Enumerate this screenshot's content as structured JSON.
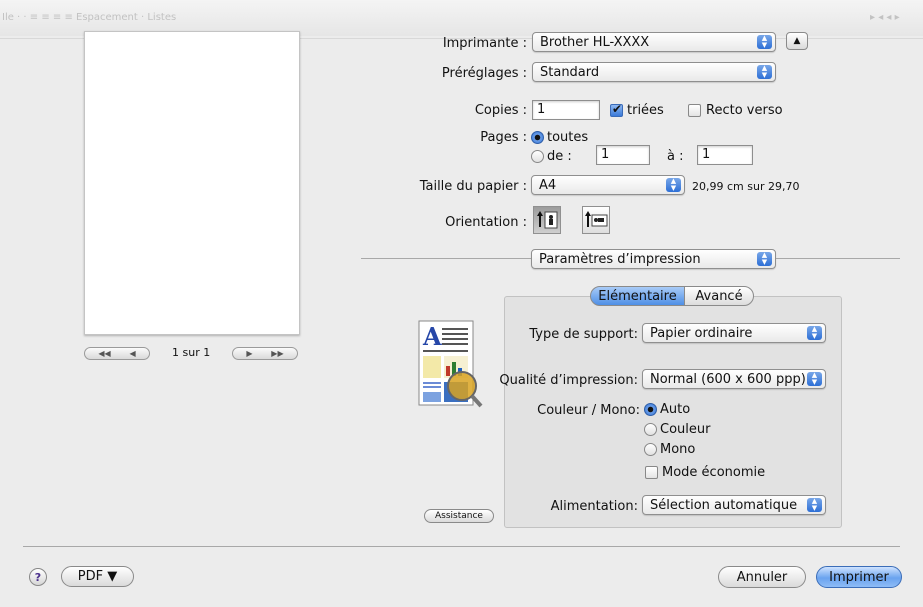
{
  "background_toolbar": {
    "text": "Ile · · ≡ ≡ ≡ ≡  Espacement  ·  Listes"
  },
  "preview": {
    "page_indicator": "1 sur 1"
  },
  "printer": {
    "label": "Imprimante :",
    "value": "Brother HL-XXXX"
  },
  "presets": {
    "label": "Préréglages :",
    "value": "Standard"
  },
  "copies": {
    "label": "Copies :",
    "value": "1",
    "collated_label": "triées",
    "collated": true,
    "duplex_label": "Recto verso",
    "duplex": false
  },
  "pages": {
    "label": "Pages :",
    "all_label": "toutes",
    "from_label": "de :",
    "from_value": "1",
    "to_label": "à :",
    "to_value": "1",
    "selected": "all"
  },
  "paper": {
    "label": "Taille du papier :",
    "value": "A4",
    "dimensions": "20,99 cm sur 29,70"
  },
  "orientation": {
    "label": "Orientation :",
    "selected": "portrait"
  },
  "section": {
    "value": "Paramètres d’impression"
  },
  "tabs": [
    {
      "label": "Elémentaire",
      "active": true
    },
    {
      "label": "Avancé",
      "active": false
    }
  ],
  "media_type": {
    "label": "Type de support:",
    "value": "Papier ordinaire"
  },
  "quality": {
    "label": "Qualité d’impression:",
    "value": "Normal (600 x 600 ppp)"
  },
  "color_mode": {
    "label": "Couleur / Mono:",
    "options": [
      "Auto",
      "Couleur",
      "Mono"
    ],
    "selected": "Auto",
    "economy_label": "Mode économie",
    "economy": false
  },
  "source": {
    "label": "Alimentation:",
    "value": "Sélection automatique"
  },
  "assistance_label": "Assistance",
  "footer": {
    "help": "?",
    "pdf_label": "PDF ▼",
    "cancel_label": "Annuler",
    "print_label": "Imprimer"
  },
  "colors": {
    "accent": "#3a7ad8",
    "default_button": "#6aa3ef",
    "sheet": "#ececec"
  }
}
